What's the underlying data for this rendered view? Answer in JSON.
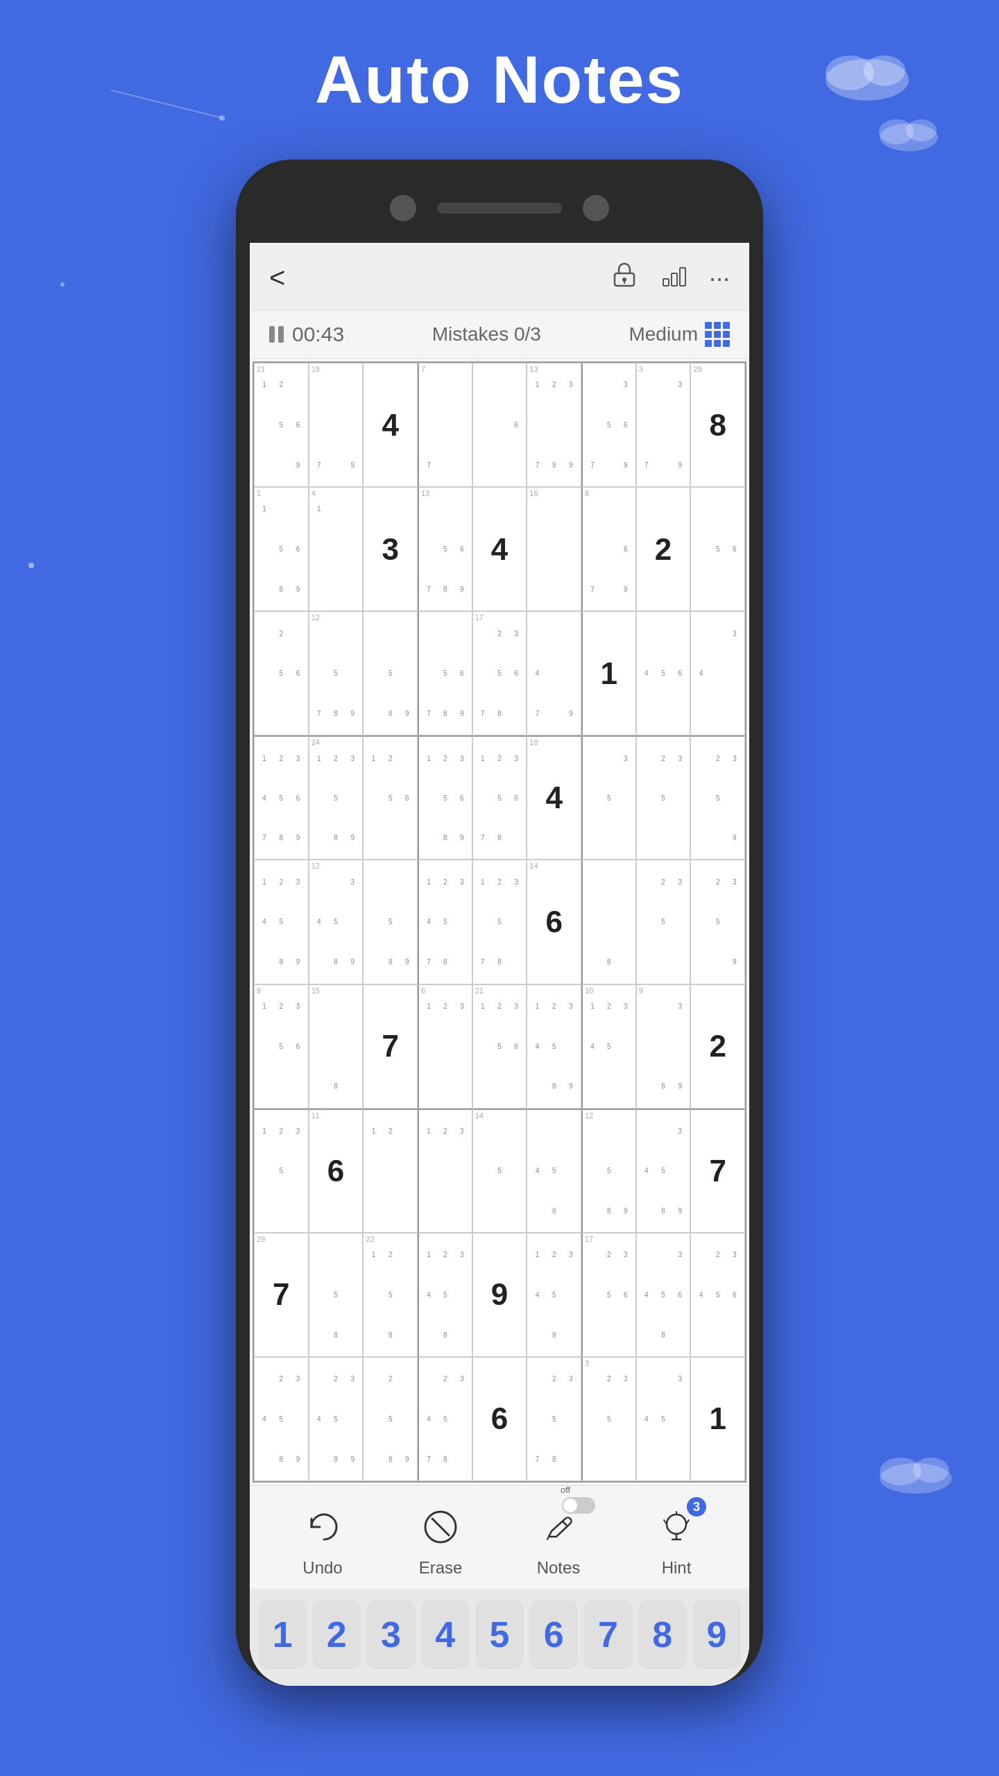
{
  "page": {
    "title": "Auto Notes",
    "background_color": "#4169e1"
  },
  "header": {
    "back_label": "‹",
    "icons": [
      "lock-icon",
      "chart-icon",
      "more-icon"
    ],
    "timer": "00:43",
    "mistakes_label": "Mistakes 0/3",
    "difficulty": "Medium"
  },
  "toolbar": {
    "undo_label": "Undo",
    "erase_label": "Erase",
    "notes_label": "Notes",
    "hint_label": "Hint",
    "notes_toggle": "off",
    "hint_count": "3"
  },
  "number_pad": {
    "numbers": [
      "1",
      "2",
      "3",
      "4",
      "5",
      "6",
      "7",
      "8",
      "9"
    ]
  },
  "grid": {
    "cells": [
      {
        "val": "",
        "notes": "1 2\n5 6\n  9",
        "index": "21"
      },
      {
        "val": "",
        "notes": "    \n    \n7  9",
        "index": "19"
      },
      {
        "val": "4",
        "notes": "",
        "index": ""
      },
      {
        "val": "",
        "notes": "    \n    \n7  ",
        "index": "7"
      },
      {
        "val": "",
        "notes": "    \n6  \n    ",
        "index": ""
      },
      {
        "val": "",
        "notes": "1 2 3\n    \n7 8 9",
        "index": "13"
      },
      {
        "val": "",
        "notes": "3\n5 6\n7   9",
        "index": ""
      },
      {
        "val": "",
        "notes": "3\n    \n7   9",
        "index": "3"
      },
      {
        "val": "8",
        "notes": "",
        "index": "29"
      },
      {
        "val": "",
        "notes": "1  \n5 6\n8 9",
        "index": "1"
      },
      {
        "val": "",
        "notes": "  1\n    \n    ",
        "index": "4"
      },
      {
        "val": "3",
        "notes": "",
        "index": ""
      },
      {
        "val": "",
        "notes": "    \n5 6\n7 8 9",
        "index": "13"
      },
      {
        "val": "4",
        "notes": "",
        "index": ""
      },
      {
        "val": "",
        "notes": "    \n    \n    ",
        "index": "16"
      },
      {
        "val": "",
        "notes": "  \n6  \n7  9",
        "index": "8"
      },
      {
        "val": "2",
        "notes": "",
        "index": ""
      },
      {
        "val": "",
        "notes": "5 6\n    \n    ",
        "index": ""
      },
      {
        "val": "",
        "notes": "2  \n5 6\n    ",
        "index": ""
      },
      {
        "val": "",
        "notes": "    \n5  \n7 8 9",
        "index": "12"
      },
      {
        "val": "",
        "notes": "5  \n    \n8 9",
        "index": ""
      },
      {
        "val": "",
        "notes": "5 6\n    \n7 8 9",
        "index": ""
      },
      {
        "val": "",
        "notes": "2 3\n5 6\n7 8",
        "index": "17"
      },
      {
        "val": "",
        "notes": "4  \n    \n7  9",
        "index": ""
      },
      {
        "val": "1",
        "notes": "",
        "index": ""
      },
      {
        "val": "",
        "notes": "4 5 6\n    \n    ",
        "index": ""
      },
      {
        "val": "",
        "notes": "4 3\n    \n    ",
        "index": ""
      },
      {
        "val": "",
        "notes": "1 2 3\n4 5 6\n7 8 9",
        "index": ""
      },
      {
        "val": "",
        "notes": "1 2 3\n    5\n8 9",
        "index": "24"
      },
      {
        "val": "",
        "notes": "1 2\n5 6\n    ",
        "index": ""
      },
      {
        "val": "",
        "notes": "1 2 3\n5 6\n8 9",
        "index": ""
      },
      {
        "val": "",
        "notes": "1 2 3\n5 6\n7 8",
        "index": ""
      },
      {
        "val": "4",
        "notes": "",
        "index": "18"
      },
      {
        "val": "",
        "notes": "  3\n    5\n    ",
        "index": ""
      },
      {
        "val": "",
        "notes": "2 3\n    5\n    ",
        "index": ""
      },
      {
        "val": "",
        "notes": "2 3\n    5\n    9",
        "index": ""
      },
      {
        "val": "",
        "notes": "1 2 3\n4 5\n8 9",
        "index": ""
      },
      {
        "val": "",
        "notes": "  3\n4 5\n8 9",
        "index": "12"
      },
      {
        "val": "",
        "notes": "    \n    5\n8 9",
        "index": ""
      },
      {
        "val": "",
        "notes": "1 2 3\n4 5\n7 8",
        "index": ""
      },
      {
        "val": "",
        "notes": "1 2 3\n    5\n7 8",
        "index": ""
      },
      {
        "val": "6",
        "notes": "",
        "index": "14"
      },
      {
        "val": "",
        "notes": "  8\n    \n    ",
        "index": ""
      },
      {
        "val": "",
        "notes": "2 3\n    5\n    ",
        "index": ""
      },
      {
        "val": "",
        "notes": "2 3\n    5\n    9",
        "index": ""
      },
      {
        "val": "",
        "notes": "  \n1 2 3\n5 6",
        "index": "8"
      },
      {
        "val": "",
        "notes": "    \n    \n    8",
        "index": "15"
      },
      {
        "val": "7",
        "notes": "",
        "index": ""
      },
      {
        "val": "",
        "notes": "1 2 3\n    \n    ",
        "index": "6"
      },
      {
        "val": "",
        "notes": "1 2 3\n5 6\n    ",
        "index": "21"
      },
      {
        "val": "",
        "notes": "1 2 3\n4 5\n8 9",
        "index": ""
      },
      {
        "val": "",
        "notes": "1 2 3\n4 5\n    ",
        "index": "10"
      },
      {
        "val": "",
        "notes": "  3\n    \n8 9",
        "index": "9"
      },
      {
        "val": "2",
        "notes": "",
        "index": ""
      },
      {
        "val": "",
        "notes": "1 2 3\n    5\n    ",
        "index": ""
      },
      {
        "val": "6",
        "notes": "",
        "index": "11"
      },
      {
        "val": "",
        "notes": "1 2\n    \n    ",
        "index": ""
      },
      {
        "val": "",
        "notes": "1 2 3\n    \n    ",
        "index": ""
      },
      {
        "val": "",
        "notes": "  5\n    \n    ",
        "index": "14"
      },
      {
        "val": "",
        "notes": "4 5\n    8\n    ",
        "index": ""
      },
      {
        "val": "",
        "notes": "5  \n8 9\n    ",
        "index": "12"
      },
      {
        "val": "",
        "notes": "  3\n4 5\n8 9",
        "index": ""
      },
      {
        "val": "7",
        "notes": "",
        "index": ""
      },
      {
        "val": "7",
        "notes": "",
        "index": "29"
      },
      {
        "val": "",
        "notes": "    5\n    \n    8",
        "index": ""
      },
      {
        "val": "",
        "notes": "1 2\n    5\n    8",
        "index": "22"
      },
      {
        "val": "",
        "notes": "1 2 3\n4 5\n    8",
        "index": ""
      },
      {
        "val": "9",
        "notes": "",
        "index": ""
      },
      {
        "val": "",
        "notes": "1 2 3\n4 5\n    8",
        "index": ""
      },
      {
        "val": "",
        "notes": "2 3\n5 6\n    ",
        "index": "17"
      },
      {
        "val": "",
        "notes": "  3\n4 5 6\n    8",
        "index": ""
      },
      {
        "val": "",
        "notes": "2 3\n4 5 6\n    ",
        "index": ""
      },
      {
        "val": "",
        "notes": "2 3\n4 5\n8 9",
        "index": ""
      },
      {
        "val": "",
        "notes": "2 3\n4 5\n8 9",
        "index": ""
      },
      {
        "val": "",
        "notes": "2  \n    5\n8 9",
        "index": ""
      },
      {
        "val": "",
        "notes": "2 3\n4 5\n7 8",
        "index": ""
      },
      {
        "val": "6",
        "notes": "",
        "index": ""
      },
      {
        "val": "",
        "notes": "2 3\n    5\n7 8",
        "index": ""
      },
      {
        "val": "",
        "notes": "2 3\n    5\n    ",
        "index": "3"
      },
      {
        "val": "",
        "notes": "  3\n4 5\n    ",
        "index": ""
      },
      {
        "val": "1",
        "notes": "",
        "index": ""
      }
    ]
  }
}
